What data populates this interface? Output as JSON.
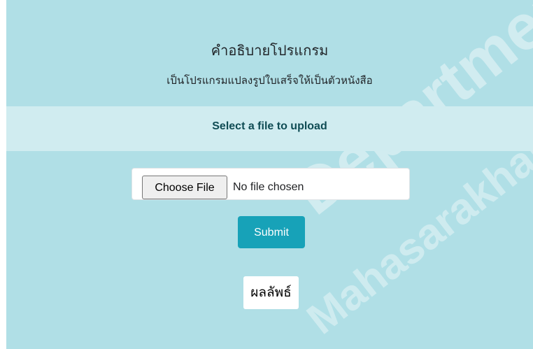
{
  "header": {
    "title": "คำอธิบายโปรแกรม",
    "description": "เป็นโปรแกรมแปลงรูปใบเสร็จให้เป็นตัวหนังสือ"
  },
  "upload": {
    "label": "Select a file to upload",
    "choose_button": "Choose File",
    "file_status": "No file chosen",
    "submit_label": "Submit"
  },
  "result": {
    "label": "ผลลัพธ์"
  },
  "watermark": {
    "line1": "Department",
    "line2": "Mahasarakham Univ"
  },
  "colors": {
    "background": "#b0dfe6",
    "band": "#d0ecf0",
    "submit": "#17a2b8",
    "band_text": "#0f4c54"
  }
}
